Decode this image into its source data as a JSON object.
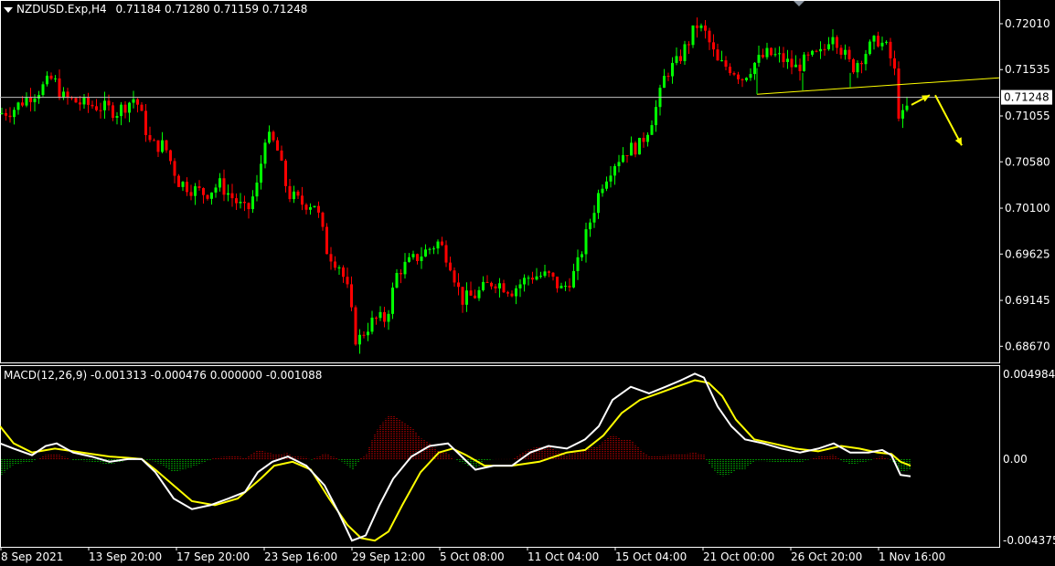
{
  "window": {
    "symbol_label": "NZDUSD.Exp,H4",
    "ohlc": "0.71184 0.71280 0.71159 0.71248"
  },
  "price_axis": {
    "ticks": [
      "0.72010",
      "0.71535",
      "0.71055",
      "0.70580",
      "0.70100",
      "0.69625",
      "0.69145",
      "0.68670"
    ],
    "current_price": "0.71248"
  },
  "macd_panel": {
    "label": "MACD(12,26,9) -0.001313 -0.000476 0.000000 -0.001088",
    "ticks": [
      "0.004984",
      "0.00",
      "-0.004375"
    ]
  },
  "time_axis": {
    "labels": [
      "8 Sep 2021",
      "13 Sep 20:00",
      "17 Sep 20:00",
      "23 Sep 16:00",
      "29 Sep 12:00",
      "5 Oct 08:00",
      "11 Oct 04:00",
      "15 Oct 04:00",
      "21 Oct 00:00",
      "26 Oct 20:00",
      "1 Nov 16:00"
    ]
  },
  "colors": {
    "bull": "#00ff00",
    "bear": "#ff0000",
    "background": "#000000",
    "grid_frame": "#ffffff",
    "trendline": "#ffff00",
    "arrow": "#ffff00",
    "bid_line": "#c0c0c0",
    "macd_main": "#ffffff",
    "macd_signal": "#ffff00"
  },
  "chart_data": {
    "type": "candlestick",
    "symbol": "NZDUSD.Exp",
    "timeframe": "H4",
    "y_range": [
      0.6855,
      0.7218
    ],
    "close_path": [
      [
        0,
        0.7108
      ],
      [
        14,
        0.7112
      ],
      [
        30,
        0.7125
      ],
      [
        44,
        0.7133
      ],
      [
        58,
        0.7145
      ],
      [
        68,
        0.7125
      ],
      [
        90,
        0.7118
      ],
      [
        110,
        0.7115
      ],
      [
        128,
        0.711
      ],
      [
        148,
        0.7125
      ],
      [
        165,
        0.7075
      ],
      [
        180,
        0.7075
      ],
      [
        195,
        0.7038
      ],
      [
        210,
        0.703
      ],
      [
        225,
        0.7025
      ],
      [
        240,
        0.7035
      ],
      [
        255,
        0.702
      ],
      [
        270,
        0.7005
      ],
      [
        282,
        0.7035
      ],
      [
        290,
        0.7085
      ],
      [
        302,
        0.7075
      ],
      [
        315,
        0.7025
      ],
      [
        330,
        0.7015
      ],
      [
        345,
        0.7015
      ],
      [
        358,
        0.6965
      ],
      [
        372,
        0.695
      ],
      [
        380,
        0.6925
      ],
      [
        390,
        0.687
      ],
      [
        400,
        0.6885
      ],
      [
        410,
        0.6895
      ],
      [
        422,
        0.6895
      ],
      [
        435,
        0.6945
      ],
      [
        450,
        0.6955
      ],
      [
        465,
        0.6965
      ],
      [
        480,
        0.6975
      ],
      [
        492,
        0.6955
      ],
      [
        505,
        0.6915
      ],
      [
        520,
        0.692
      ],
      [
        540,
        0.6935
      ],
      [
        560,
        0.6925
      ],
      [
        580,
        0.694
      ],
      [
        600,
        0.694
      ],
      [
        615,
        0.6925
      ],
      [
        630,
        0.6945
      ],
      [
        645,
        0.6995
      ],
      [
        658,
        0.7035
      ],
      [
        670,
        0.7055
      ],
      [
        685,
        0.707
      ],
      [
        700,
        0.7075
      ],
      [
        710,
        0.7095
      ],
      [
        720,
        0.712
      ],
      [
        728,
        0.715
      ],
      [
        740,
        0.716
      ],
      [
        752,
        0.718
      ],
      [
        762,
        0.72
      ],
      [
        772,
        0.719
      ],
      [
        785,
        0.716
      ],
      [
        800,
        0.7155
      ],
      [
        812,
        0.7145
      ],
      [
        825,
        0.716
      ],
      [
        840,
        0.717
      ],
      [
        855,
        0.7165
      ],
      [
        870,
        0.7155
      ],
      [
        885,
        0.7165
      ],
      [
        900,
        0.717
      ],
      [
        910,
        0.7195
      ],
      [
        920,
        0.7175
      ],
      [
        932,
        0.7155
      ],
      [
        945,
        0.717
      ],
      [
        960,
        0.7185
      ],
      [
        970,
        0.7175
      ],
      [
        978,
        0.7155
      ],
      [
        984,
        0.71
      ],
      [
        990,
        0.7108
      ],
      [
        996,
        0.7124
      ]
    ],
    "trendline": [
      [
        828,
        0.7128
      ],
      [
        1093,
        0.7145
      ]
    ],
    "support_segments": [
      [
        828,
        0.7128,
        0.7155
      ],
      [
        878,
        0.7132,
        0.715
      ],
      [
        930,
        0.7135,
        0.715
      ]
    ],
    "arrows": [
      [
        [
          997,
          0.7117
        ],
        [
          1017,
          0.7127
        ]
      ],
      [
        [
          1023,
          0.7127
        ],
        [
          1052,
          0.7075
        ]
      ]
    ],
    "macd": {
      "main": [
        [
          0,
          0.0012
        ],
        [
          15,
          0.0008
        ],
        [
          35,
          0.0003
        ],
        [
          50,
          0.001
        ],
        [
          62,
          0.0012
        ],
        [
          80,
          0.0005
        ],
        [
          100,
          0.0002
        ],
        [
          120,
          -0.0002
        ],
        [
          140,
          0.0
        ],
        [
          155,
          0.0
        ],
        [
          170,
          -0.001
        ],
        [
          190,
          -0.003
        ],
        [
          210,
          -0.0038
        ],
        [
          230,
          -0.0035
        ],
        [
          250,
          -0.003
        ],
        [
          268,
          -0.0025
        ],
        [
          282,
          -0.001
        ],
        [
          298,
          -0.0002
        ],
        [
          315,
          0.0002
        ],
        [
          335,
          -0.0005
        ],
        [
          355,
          -0.002
        ],
        [
          370,
          -0.004
        ],
        [
          385,
          -0.0062
        ],
        [
          400,
          -0.0058
        ],
        [
          415,
          -0.0035
        ],
        [
          430,
          -0.0015
        ],
        [
          450,
          0.0002
        ],
        [
          470,
          0.001
        ],
        [
          490,
          0.0012
        ],
        [
          505,
          0.0002
        ],
        [
          520,
          -0.0008
        ],
        [
          540,
          -0.0005
        ],
        [
          560,
          -0.0005
        ],
        [
          580,
          0.0005
        ],
        [
          600,
          0.001
        ],
        [
          620,
          0.0008
        ],
        [
          640,
          0.0015
        ],
        [
          655,
          0.0025
        ],
        [
          670,
          0.0045
        ],
        [
          690,
          0.0055
        ],
        [
          710,
          0.005
        ],
        [
          728,
          0.0055
        ],
        [
          745,
          0.006
        ],
        [
          760,
          0.0065
        ],
        [
          770,
          0.0062
        ],
        [
          785,
          0.004
        ],
        [
          800,
          0.0025
        ],
        [
          815,
          0.0015
        ],
        [
          835,
          0.0012
        ],
        [
          855,
          0.0008
        ],
        [
          875,
          0.0005
        ],
        [
          895,
          0.0008
        ],
        [
          912,
          0.0012
        ],
        [
          930,
          0.0005
        ],
        [
          950,
          0.0005
        ],
        [
          965,
          0.0007
        ],
        [
          975,
          0.0003
        ],
        [
          985,
          -0.0012
        ],
        [
          996,
          -0.0013
        ]
      ],
      "signal": [
        [
          0,
          0.0025
        ],
        [
          15,
          0.0012
        ],
        [
          35,
          0.0005
        ],
        [
          60,
          0.0008
        ],
        [
          80,
          0.0006
        ],
        [
          100,
          0.0004
        ],
        [
          120,
          0.0002
        ],
        [
          140,
          0.0001
        ],
        [
          155,
          0.0
        ],
        [
          170,
          -0.0008
        ],
        [
          190,
          -0.002
        ],
        [
          210,
          -0.0032
        ],
        [
          235,
          -0.0035
        ],
        [
          260,
          -0.003
        ],
        [
          285,
          -0.0015
        ],
        [
          300,
          -0.0005
        ],
        [
          320,
          -0.0002
        ],
        [
          340,
          -0.0008
        ],
        [
          360,
          -0.003
        ],
        [
          380,
          -0.005
        ],
        [
          395,
          -0.006
        ],
        [
          410,
          -0.0062
        ],
        [
          425,
          -0.0055
        ],
        [
          440,
          -0.0035
        ],
        [
          460,
          -0.001
        ],
        [
          480,
          0.0005
        ],
        [
          495,
          0.0008
        ],
        [
          510,
          0.0003
        ],
        [
          530,
          -0.0005
        ],
        [
          560,
          -0.0005
        ],
        [
          590,
          -0.0002
        ],
        [
          620,
          0.0005
        ],
        [
          640,
          0.0007
        ],
        [
          660,
          0.0018
        ],
        [
          680,
          0.0035
        ],
        [
          700,
          0.0045
        ],
        [
          720,
          0.005
        ],
        [
          740,
          0.0055
        ],
        [
          760,
          0.006
        ],
        [
          775,
          0.0058
        ],
        [
          790,
          0.0048
        ],
        [
          805,
          0.003
        ],
        [
          825,
          0.0015
        ],
        [
          845,
          0.0012
        ],
        [
          870,
          0.0008
        ],
        [
          895,
          0.0006
        ],
        [
          920,
          0.001
        ],
        [
          940,
          0.0008
        ],
        [
          960,
          0.0005
        ],
        [
          975,
          0.0004
        ],
        [
          985,
          -0.0002
        ],
        [
          996,
          -0.0005
        ]
      ],
      "y_range": [
        -0.0066,
        0.0068
      ]
    }
  }
}
